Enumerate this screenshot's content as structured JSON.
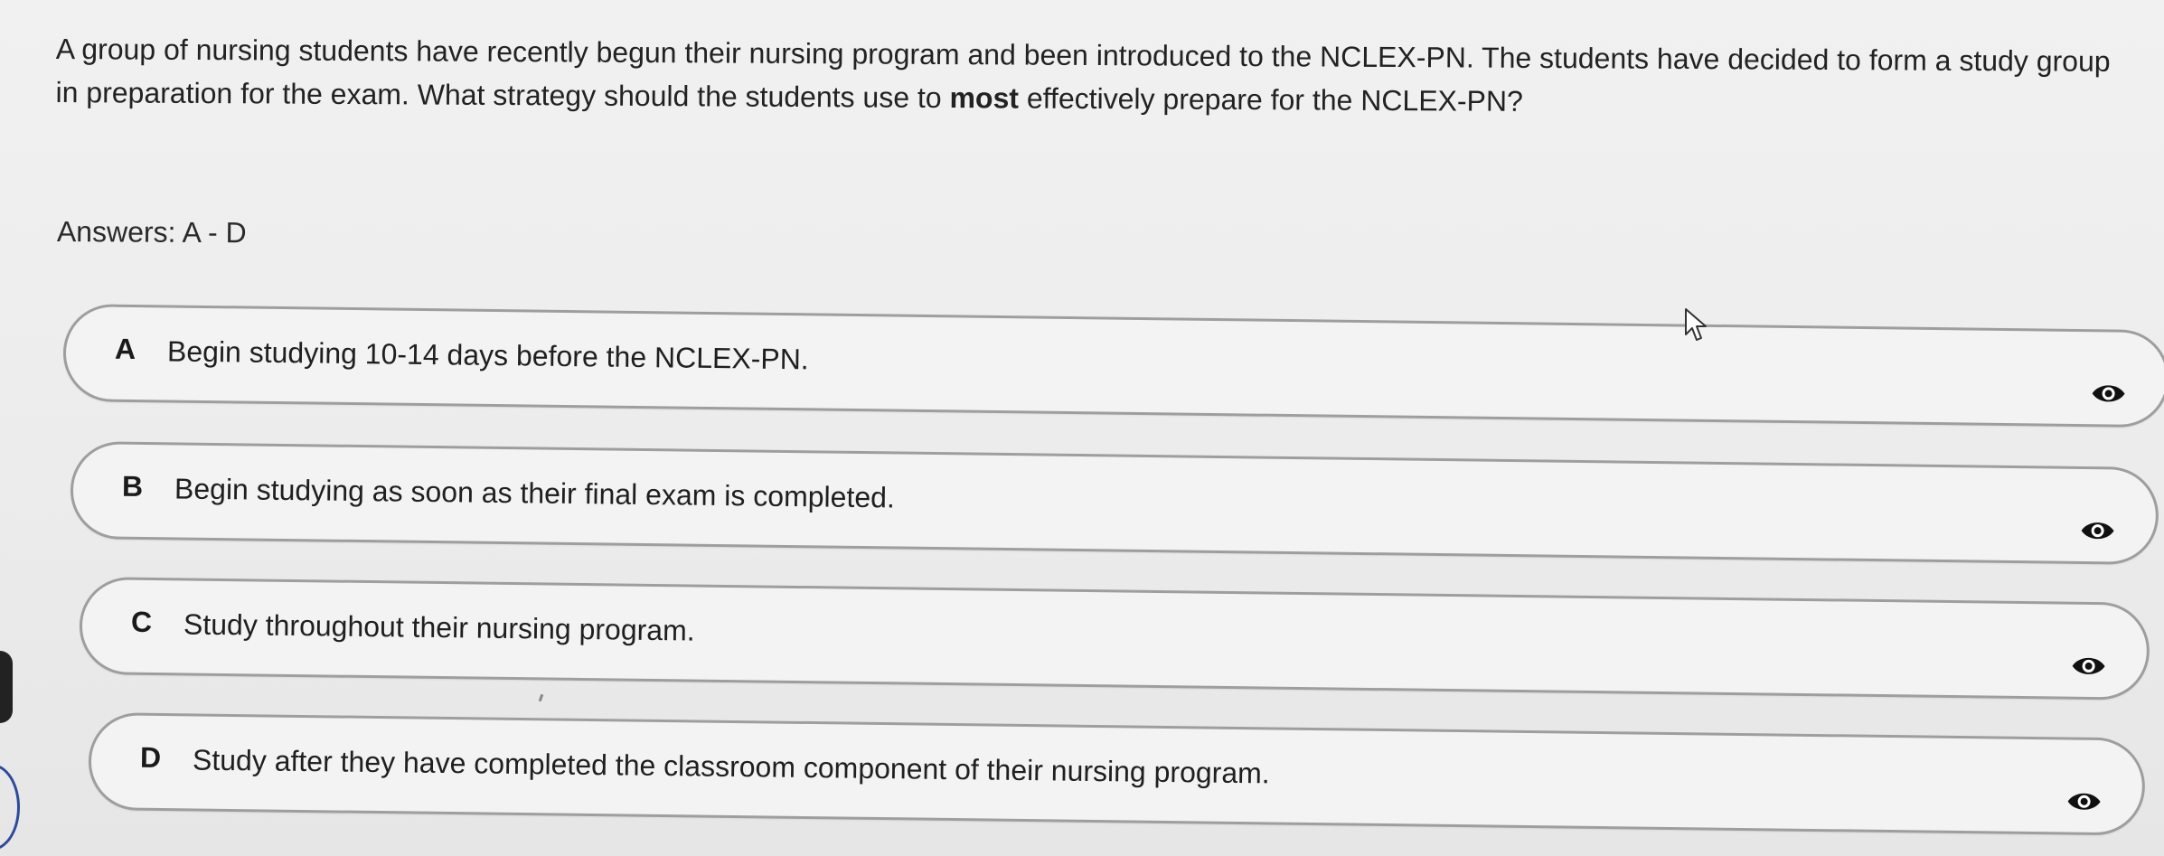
{
  "question": {
    "text_before": "A group of nursing students have recently begun their nursing program and been introduced to the NCLEX-PN. The students have decided to form a study group in preparation for the exam. What strategy should the students use to ",
    "emphasis": "most",
    "text_after": " effectively prepare for the NCLEX-PN?"
  },
  "answers_label": "Answers: A - D",
  "options": [
    {
      "letter": "A",
      "text": "Begin studying 10-14 days before the NCLEX-PN.",
      "icon": "eye-icon"
    },
    {
      "letter": "B",
      "text": "Begin studying as soon as their final exam is completed.",
      "icon": "eye-icon"
    },
    {
      "letter": "C",
      "text": "Study throughout their nursing program.",
      "icon": "eye-icon"
    },
    {
      "letter": "D",
      "text": "Study after they have completed the classroom component of their nursing program.",
      "icon": "eye-icon"
    }
  ],
  "colors": {
    "option_border": "#9e9e9e",
    "background": "#ececec",
    "text": "#1f1f1f"
  }
}
